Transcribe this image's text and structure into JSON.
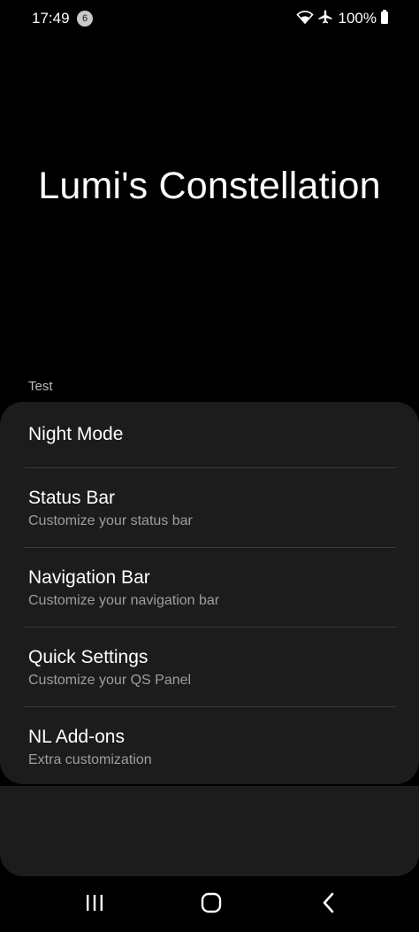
{
  "status_bar": {
    "time": "17:49",
    "notification_count": "6",
    "battery": "100%",
    "icons": [
      "wifi-icon",
      "airplane-icon",
      "battery-icon"
    ]
  },
  "app": {
    "title": "Lumi's Constellation"
  },
  "section": {
    "header": "Test"
  },
  "items": [
    {
      "title": "Night Mode",
      "subtitle": ""
    },
    {
      "title": "Status Bar",
      "subtitle": "Customize your status bar"
    },
    {
      "title": "Navigation Bar",
      "subtitle": "Customize your navigation bar"
    },
    {
      "title": "Quick Settings",
      "subtitle": "Customize your QS Panel"
    },
    {
      "title": "NL Add-ons",
      "subtitle": "Extra customization"
    }
  ],
  "nav": {
    "icons": [
      "recents-icon",
      "home-icon",
      "back-icon"
    ]
  },
  "colors": {
    "background": "#000000",
    "card": "#1c1c1c",
    "primary_text": "#ffffff",
    "secondary_text": "#9e9e9e",
    "divider": "#3a3a3a"
  }
}
